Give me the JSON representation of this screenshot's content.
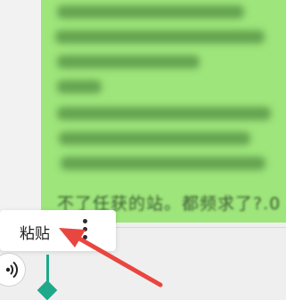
{
  "message": {
    "visible_text": "不了任获的站。都频求了?.0"
  },
  "context_menu": {
    "paste_label": "粘贴",
    "more_icon": "more-vert-icon"
  },
  "input_bar": {
    "voice_icon": "speaker-icon"
  },
  "annotation": {
    "arrow_color": "#e8463f"
  },
  "colors": {
    "bubble": "#9ee57b",
    "cursor": "#1fa88a"
  }
}
